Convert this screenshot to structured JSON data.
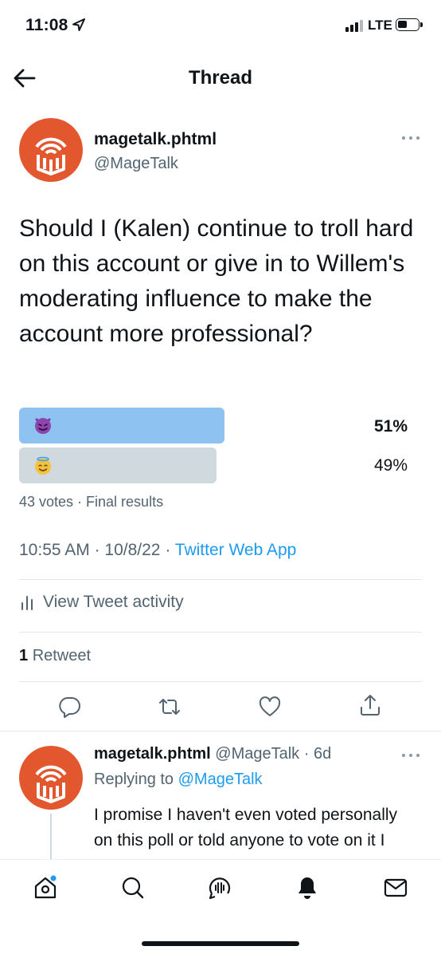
{
  "status_bar": {
    "time": "11:08",
    "network": "LTE",
    "icons": [
      "location-arrow-icon",
      "signal-icon",
      "battery-icon"
    ]
  },
  "header": {
    "title": "Thread",
    "back_icon": "arrow-left-icon"
  },
  "tweet": {
    "author_name": "magetalk.phtml",
    "author_handle": "@MageTalk",
    "text": "Should I (Kalen) continue to troll hard on this account or give in to Willem's moderating influence to make the account more professional?",
    "poll": {
      "options": [
        {
          "emoji": "smiling-face-with-horns",
          "percent": "51%",
          "value": 51,
          "winner": true
        },
        {
          "emoji": "smiling-face-with-halo",
          "percent": "49%",
          "value": 49,
          "winner": false
        }
      ],
      "meta": "43 votes · Final results"
    },
    "time": "10:55 AM",
    "date": "10/8/22",
    "source": "Twitter Web App",
    "activity_label": "View Tweet activity",
    "retweet_count": "1",
    "retweet_label": "Retweet",
    "actions": [
      "reply-icon",
      "retweet-icon",
      "like-icon",
      "share-icon"
    ]
  },
  "reply": {
    "author_name": "magetalk.phtml",
    "author_handle": "@MageTalk",
    "age": "6d",
    "replying_label": "Replying to",
    "replying_to": "@MageTalk",
    "text": "I promise I haven't even voted personally on this poll or told anyone to vote on it I honestly kinda want to"
  },
  "tabbar": {
    "icons": [
      "home-icon",
      "search-icon",
      "spaces-icon",
      "notifications-icon",
      "messages-icon"
    ]
  },
  "colors": {
    "accent": "#1d9bf0",
    "avatar": "#e2572e",
    "poll_winner": "#8ec2f1",
    "poll_other": "#cfd9de",
    "secondary_text": "#536471"
  }
}
